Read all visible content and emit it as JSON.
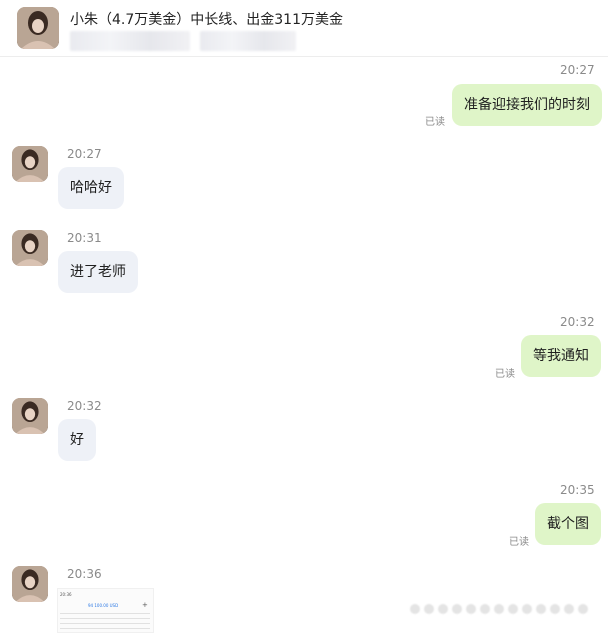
{
  "header": {
    "title": "小朱（4.7万美金）中长线、出金311万美金"
  },
  "messages": [
    {
      "side": "me",
      "time": "20:27",
      "text": "准备迎接我们的时刻",
      "status": "已读"
    },
    {
      "side": "them",
      "time": "20:27",
      "text": "哈哈好"
    },
    {
      "side": "them",
      "time": "20:31",
      "text": "进了老师"
    },
    {
      "side": "me",
      "time": "20:32",
      "text": "等我通知",
      "status": "已读"
    },
    {
      "side": "them",
      "time": "20:32",
      "text": "好"
    },
    {
      "side": "me",
      "time": "20:35",
      "text": "截个图",
      "status": "已读"
    },
    {
      "side": "them",
      "time": "20:36",
      "type": "image"
    }
  ],
  "thumbnail": {
    "clock": "20:36",
    "amount": "94 100.00 USD"
  },
  "colors": {
    "my_bubble": "#dff5c8",
    "their_bubble": "#eef1f7",
    "meta_text": "#8a8a8a"
  }
}
